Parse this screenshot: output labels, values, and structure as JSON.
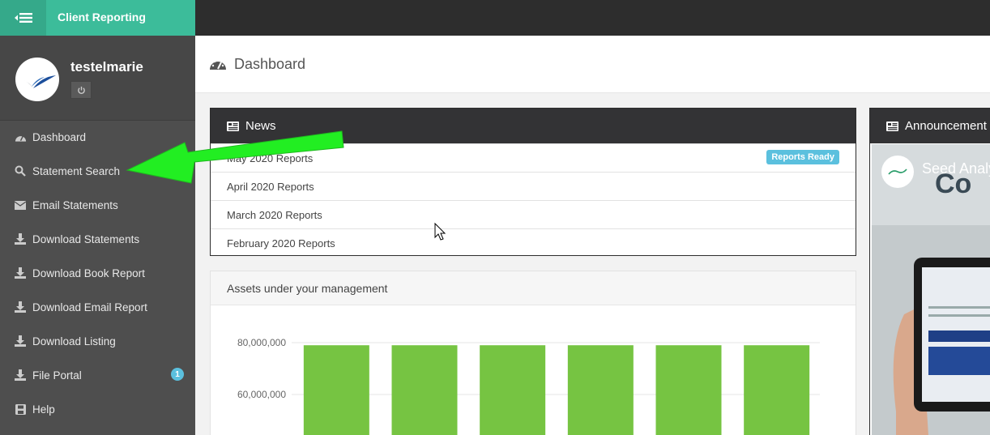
{
  "header": {
    "app_title": "Client Reporting"
  },
  "profile": {
    "username": "testelmarie"
  },
  "sidebar": {
    "items": [
      {
        "label": "Dashboard",
        "icon": "dashboard-icon"
      },
      {
        "label": "Statement Search",
        "icon": "search-icon"
      },
      {
        "label": "Email Statements",
        "icon": "envelope-icon"
      },
      {
        "label": "Download Statements",
        "icon": "download-icon"
      },
      {
        "label": "Download Book Report",
        "icon": "download-icon"
      },
      {
        "label": "Download Email Report",
        "icon": "download-icon"
      },
      {
        "label": "Download Listing",
        "icon": "download-icon"
      },
      {
        "label": "File Portal",
        "icon": "download-icon",
        "badge": "1"
      },
      {
        "label": "Help",
        "icon": "save-icon"
      }
    ]
  },
  "page": {
    "title": "Dashboard"
  },
  "news": {
    "title": "News",
    "items": [
      {
        "label": "May 2020 Reports",
        "badge": "Reports Ready"
      },
      {
        "label": "April 2020 Reports"
      },
      {
        "label": "March 2020 Reports"
      },
      {
        "label": "February 2020 Reports"
      }
    ]
  },
  "announcement": {
    "title": "Announcement",
    "video_title": "Seed Analy"
  },
  "assets": {
    "title": "Assets under your management"
  },
  "chart_data": {
    "type": "bar",
    "title": "",
    "categories": [
      "",
      "",
      "",
      "",
      "",
      ""
    ],
    "values": [
      79000000,
      79000000,
      79000000,
      79000000,
      79000000,
      79000000
    ],
    "ytick_labels": [
      "80,000,000",
      "60,000,000"
    ],
    "yticks": [
      80000000,
      60000000
    ],
    "bar_color": "#76c442",
    "grid": true
  },
  "colors": {
    "brand": "#3cbc9a",
    "sidebar": "#4e4e4e",
    "badge": "#5bc0de",
    "arrow": "#22ee22"
  }
}
